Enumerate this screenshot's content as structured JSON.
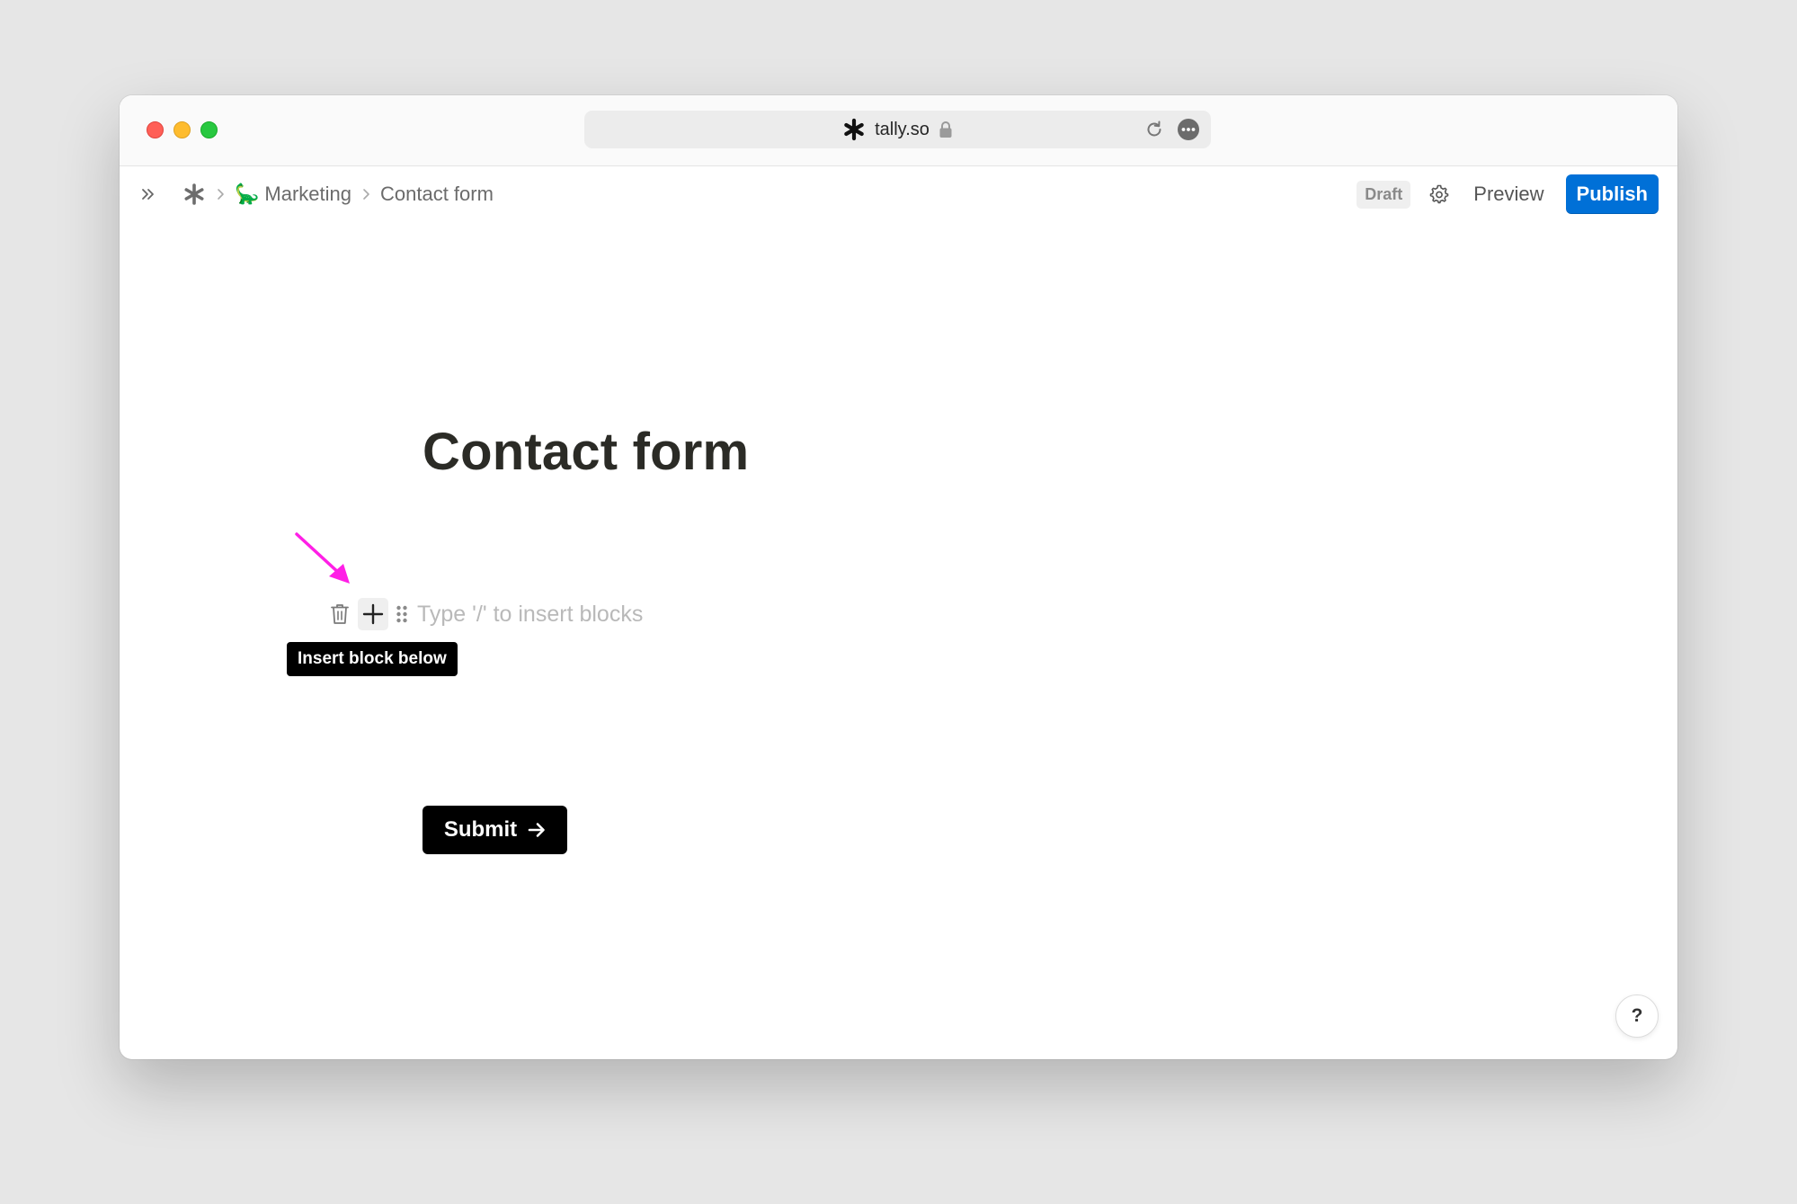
{
  "browser": {
    "url": "tally.so",
    "icons": [
      "tally-logo-icon",
      "lock-icon",
      "reload-icon",
      "more-icon"
    ]
  },
  "breadcrumb": {
    "workspace_emoji": "🦕",
    "workspace": "Marketing",
    "current": "Contact form"
  },
  "toolbar": {
    "status": "Draft",
    "preview_label": "Preview",
    "publish_label": "Publish",
    "publish_color": "#0070d7"
  },
  "form": {
    "title": "Contact form",
    "block_placeholder": "Type '/' to insert blocks",
    "tooltip": "Insert block below",
    "submit_label": "Submit"
  },
  "help": {
    "label": "?"
  },
  "annotation": {
    "arrow_color": "#ff1fe6"
  }
}
